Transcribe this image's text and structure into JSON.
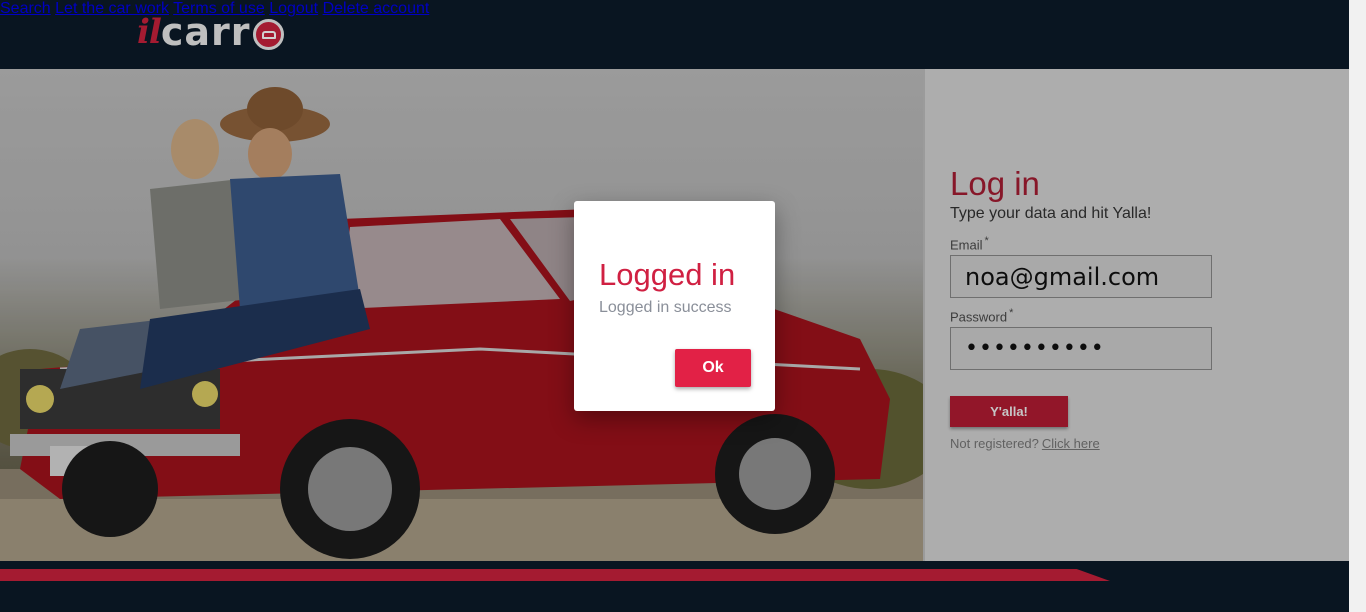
{
  "brand": {
    "logo_il": "il",
    "logo_carr": "carr"
  },
  "nav": {
    "items": [
      "Search",
      "Let the car work",
      "Terms of use",
      "Logout",
      "Delete account"
    ]
  },
  "hero": {
    "image": "couple sitting on red vintage car"
  },
  "login": {
    "title": "Log in",
    "subtitle": "Type your data and hit Yalla!",
    "email_label": "Email",
    "email_value": "noa@gmail.com",
    "password_label": "Password",
    "password_value": "••••••••••",
    "required_mark": "*",
    "submit_label": "Y'alla!",
    "not_registered": "Not registered?",
    "register_link": "Click here"
  },
  "modal": {
    "title": "Logged in",
    "message": "Logged in success",
    "ok_label": "Ok"
  },
  "colors": {
    "brand_red": "#c8213c",
    "header_bg": "#0b1a29",
    "button_red": "#e22146"
  }
}
